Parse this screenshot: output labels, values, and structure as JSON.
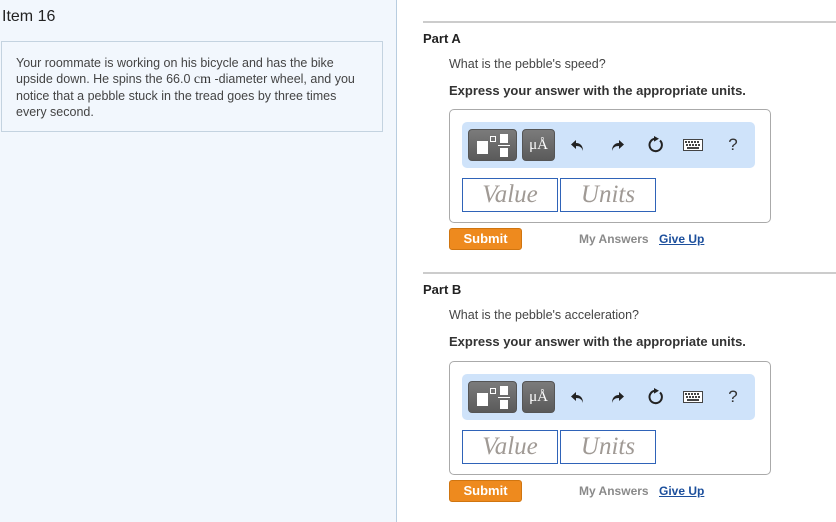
{
  "item": {
    "title": "Item 16",
    "problem_text_before": "Your roommate is working on his bicycle and has the bike upside down. He spins the 66.0 ",
    "problem_unit": "cm",
    "problem_text_after": " -diameter wheel, and you notice that a pebble stuck in the tread goes by three times every second."
  },
  "parts": [
    {
      "title": "Part A",
      "question": "What is the pebble's speed?",
      "instruction": "Express your answer with the appropriate units.",
      "toolbar": {
        "units_label": "μÅ",
        "icons": [
          "fraction-template-icon",
          "units-icon",
          "undo-icon",
          "redo-icon",
          "reset-icon",
          "keyboard-icon",
          "help-icon"
        ],
        "help_label": "?"
      },
      "value_placeholder": "Value",
      "units_placeholder": "Units",
      "submit_label": "Submit",
      "my_answers_label": "My Answers",
      "give_up_label": "Give Up"
    },
    {
      "title": "Part B",
      "question": "What is the pebble's acceleration?",
      "instruction": "Express your answer with the appropriate units.",
      "toolbar": {
        "units_label": "μÅ",
        "icons": [
          "fraction-template-icon",
          "units-icon",
          "undo-icon",
          "redo-icon",
          "reset-icon",
          "keyboard-icon",
          "help-icon"
        ],
        "help_label": "?"
      },
      "value_placeholder": "Value",
      "units_placeholder": "Units",
      "submit_label": "Submit",
      "my_answers_label": "My Answers",
      "give_up_label": "Give Up"
    }
  ],
  "colors": {
    "left_panel_bg": "#f2f7fd",
    "toolbar_bg": "#cfe3fa",
    "submit_bg": "#ee8a1e",
    "input_border": "#2f63b8",
    "link": "#1c4f9c"
  }
}
